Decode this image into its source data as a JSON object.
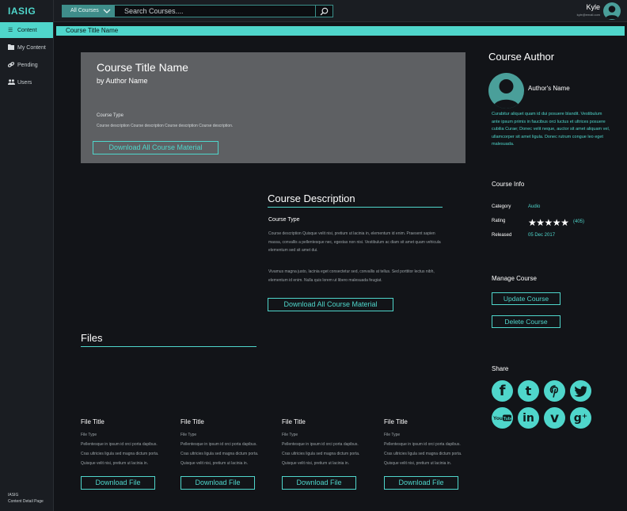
{
  "app": {
    "brand": "IASIG"
  },
  "search": {
    "category": "All Courses",
    "placeholder": "Search Courses...."
  },
  "user": {
    "name": "Kyle",
    "email": "kyle@email.com"
  },
  "sidebar": {
    "items": [
      {
        "label": "Content",
        "icon": "list-icon",
        "active": true
      },
      {
        "label": "My Content",
        "icon": "folder-icon",
        "active": false
      },
      {
        "label": "Pending",
        "icon": "link-icon",
        "active": false
      },
      {
        "label": "Users",
        "icon": "users-icon",
        "active": false
      }
    ],
    "footer_line1": "IASIG",
    "footer_line2": "Content Detail Page"
  },
  "breadcrumb": "Course Title Name",
  "hero": {
    "title": "Course Title Name",
    "author": "by Author Name",
    "type": "Course Type",
    "description": "Course description Course description Course description Course description.",
    "button": "Download All Course Material"
  },
  "description": {
    "heading": "Course Description",
    "type": "Course Type",
    "paragraph1": "Course description Quisque velit nisi, pretium ut lacinia in, elementum id enim. Praesent sapien massa, convallis a pellentesque nec, egestas non nisi. Vestibulum ac diam sit amet quam vehicula elementum sed sit amet dui.",
    "paragraph2": "Vivamus magna justo, lacinia eget consectetur sed, convallis at tellus. Sed porttitor lectus nibh, elementum id enim. Nulla quis lorem ut libero malesuada feugiat.",
    "button": "Download All Course Material"
  },
  "files": {
    "heading": "Files",
    "items": [
      {
        "title": "File Title",
        "type": "File Type",
        "desc_line1": "Pellentesque in ipsum id orci porta dapibus.",
        "desc_line2": "Cras ultricies ligula sed magna dictum porta.",
        "desc_line3": "Quisque velit nisi, pretium ut lacinia in.",
        "button": "Download File"
      },
      {
        "title": "File Title",
        "type": "File Type",
        "desc_line1": "Pellentesque in ipsum id orci porta dapibus.",
        "desc_line2": "Cras ultricies ligula sed magna dictum porta.",
        "desc_line3": "Quisque velit nisi, pretium ut lacinia in.",
        "button": "Download File"
      },
      {
        "title": "File Title",
        "type": "File Type",
        "desc_line1": "Pellentesque in ipsum id orci porta dapibus.",
        "desc_line2": "Cras ultricies ligula sed magna dictum porta.",
        "desc_line3": "Quisque velit nisi, pretium ut lacinia in.",
        "button": "Download File"
      },
      {
        "title": "File Title",
        "type": "File Type",
        "desc_line1": "Pellentesque in ipsum id orci porta dapibus.",
        "desc_line2": "Cras ultricies ligula sed magna dictum porta.",
        "desc_line3": "Quisque velit nisi, pretium ut lacinia in.",
        "button": "Download File"
      }
    ]
  },
  "author_panel": {
    "heading": "Course Author",
    "name": "Author's Name",
    "bio": "Curabitur aliquet quam id dui posuere blandit. Vestibulum ante ipsum primis in faucibus orci luctus et ultrices posuere cubilia Curae; Donec velit neque, auctor sit amet aliquam vel, ullamcorper sit amet ligula. Donec rutrum congue leo eget malesuada."
  },
  "course_info": {
    "heading": "Course Info",
    "category_label": "Category",
    "category_value": "Audio",
    "rating_label": "Rating",
    "rating_stars": 5,
    "rating_count": "(405)",
    "released_label": "Released",
    "released_value": "05 Dec 2017"
  },
  "manage": {
    "heading": "Manage Course",
    "update_button": "Update Course",
    "delete_button": "Delete Course"
  },
  "share": {
    "heading": "Share",
    "networks": [
      "facebook-icon",
      "tumblr-icon",
      "pinterest-icon",
      "twitter-icon",
      "youtube-icon",
      "linkedin-icon",
      "vimeo-icon",
      "google-plus-icon"
    ]
  },
  "colors": {
    "accent": "#4fd6cb",
    "background": "#121418",
    "panel": "#1a1d22",
    "hero": "#5e6063"
  }
}
